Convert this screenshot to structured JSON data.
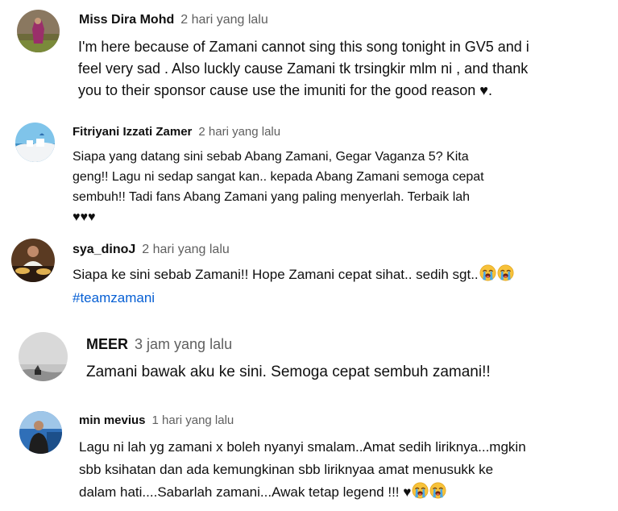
{
  "comments": [
    {
      "author": "Miss Dira Mohd",
      "time": "2 hari yang lalu",
      "lines": [
        "I'm here because of Zamani cannot sing this song tonight in GV5 and i",
        "feel very sad . Also luckly cause Zamani tk trsingkir mlm ni , and thank",
        "you to their sponsor cause use the imuniti for the good reason ♥."
      ]
    },
    {
      "author": "Fitriyani Izzati Zamer",
      "time": "2 hari yang lalu",
      "lines": [
        "Siapa yang datang sini sebab Abang Zamani, Gegar Vaganza 5? Kita",
        "geng!! Lagu ni sedap sangat kan.. kepada Abang Zamani semoga cepat",
        "sembuh!! Tadi fans Abang Zamani yang paling menyerlah. Terbaik lah",
        "♥♥♥"
      ]
    },
    {
      "author": "sya_dinoJ",
      "time": "2 hari yang lalu",
      "line1": "Siapa ke sini sebab Zamani!! Hope Zamani cepat sihat.. sedih sgt..",
      "hashtag": "#teamzamani",
      "emojis": [
        "loudly-crying-face-icon",
        "loudly-crying-face-icon"
      ]
    },
    {
      "author": "MEER",
      "time": "3 jam yang lalu",
      "lines": [
        "Zamani bawak aku ke sini. Semoga cepat sembuh zamani!!"
      ]
    },
    {
      "author": "min mevius",
      "time": "1 hari yang lalu",
      "lines": [
        "Lagu ni lah yg zamani x boleh nyanyi smalam..Amat sedih liriknya...mgkin",
        "sbb ksihatan dan ada kemungkinan sbb liriknyaa amat menusukk ke",
        "dalam hati....Sabarlah zamani...Awak tetap legend !!! ♥"
      ],
      "emojis": [
        "loudly-crying-face-icon",
        "loudly-crying-face-icon"
      ]
    }
  ],
  "colors": {
    "text": "#0f0f0f",
    "meta": "#606060",
    "link": "#065fd4"
  }
}
